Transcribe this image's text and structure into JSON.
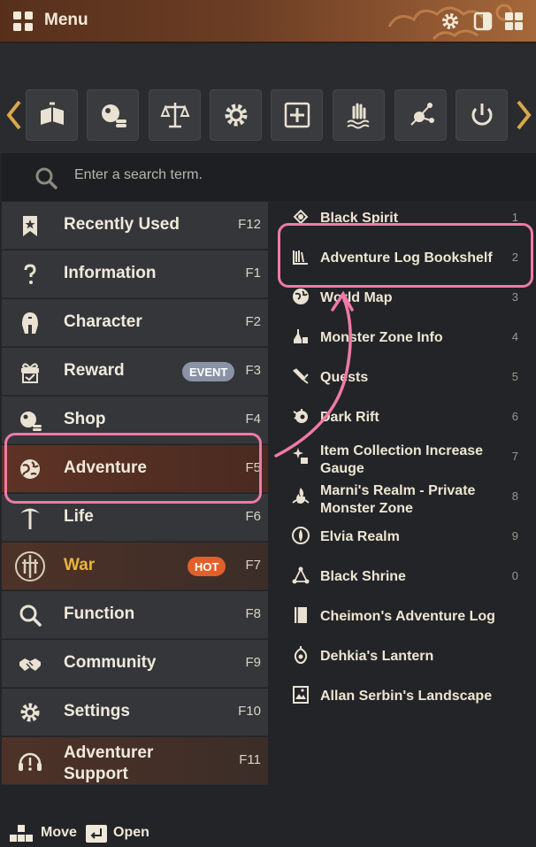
{
  "window": {
    "title": "Menu"
  },
  "search": {
    "placeholder": "Enter a search term."
  },
  "toolbar": {
    "buttons": [
      {
        "icon": "book-sword-icon"
      },
      {
        "icon": "coins-orb-icon"
      },
      {
        "icon": "balance-scale-icon"
      },
      {
        "icon": "gear-icon"
      },
      {
        "icon": "add-frame-icon"
      },
      {
        "icon": "hand-water-icon"
      },
      {
        "icon": "nodes-icon"
      },
      {
        "icon": "power-icon"
      }
    ]
  },
  "left_menu": [
    {
      "label": "Recently Used",
      "key": "F12",
      "icon": "star-bookmark-icon"
    },
    {
      "label": "Information",
      "key": "F1",
      "icon": "question-icon"
    },
    {
      "label": "Character",
      "key": "F2",
      "icon": "helmet-icon"
    },
    {
      "label": "Reward",
      "key": "F3",
      "icon": "gift-icon",
      "badge": "EVENT"
    },
    {
      "label": "Shop",
      "key": "F4",
      "icon": "coins-orb-icon"
    },
    {
      "label": "Adventure",
      "key": "F5",
      "icon": "globe-icon"
    },
    {
      "label": "Life",
      "key": "F6",
      "icon": "pickaxe-icon"
    },
    {
      "label": "War",
      "key": "F7",
      "icon": "war-shield-icon",
      "badge": "HOT"
    },
    {
      "label": "Function",
      "key": "F8",
      "icon": "magnifier-icon"
    },
    {
      "label": "Community",
      "key": "F9",
      "icon": "handshake-icon"
    },
    {
      "label": "Settings",
      "key": "F10",
      "icon": "gear-icon"
    },
    {
      "label": "Adventurer Support",
      "label_line1": "Adventurer",
      "label_line2": "Support",
      "key": "F11",
      "icon": "headset-icon"
    }
  ],
  "right_menu": [
    {
      "label": "Black Spirit",
      "num": "1",
      "icon": "black-spirit-icon"
    },
    {
      "label": "Adventure Log Bookshelf",
      "num": "2",
      "icon": "bookshelf-icon"
    },
    {
      "label": "World Map",
      "num": "3",
      "icon": "globe-icon"
    },
    {
      "label": "Monster Zone Info",
      "num": "4",
      "icon": "potion-icon"
    },
    {
      "label": "Quests",
      "num": "5",
      "icon": "scroll-quill-icon"
    },
    {
      "label": "Dark Rift",
      "num": "6",
      "icon": "dark-rift-icon"
    },
    {
      "label": "Item Collection Increase Gauge",
      "label_line1": "Item Collection Increase",
      "label_line2": "Gauge",
      "num": "7",
      "icon": "sparkle-gauge-icon"
    },
    {
      "label": "Marni's Realm - Private Monster Zone",
      "label_line1": "Marni's Realm - Private",
      "label_line2": "Monster Zone",
      "num": "8",
      "icon": "flame-realm-icon"
    },
    {
      "label": "Elvia Realm",
      "num": "9",
      "icon": "elvia-icon"
    },
    {
      "label": "Black Shrine",
      "num": "0",
      "icon": "shrine-nodes-icon"
    },
    {
      "label": "Cheimon's Adventure Log",
      "num": "",
      "icon": "log-book-icon"
    },
    {
      "label": "Dehkia's Lantern",
      "num": "",
      "icon": "lantern-icon"
    },
    {
      "label": "Allan Serbin's Landscape",
      "num": "",
      "icon": "landscape-frame-icon"
    }
  ],
  "footer": {
    "move_label": "Move",
    "open_label": "Open"
  },
  "colors": {
    "accent_pink": "#f07aa6",
    "war_gold": "#e8b53c",
    "hot_badge": "#e0602a",
    "event_badge": "#8a93a6",
    "active_row": "#5e3325"
  }
}
